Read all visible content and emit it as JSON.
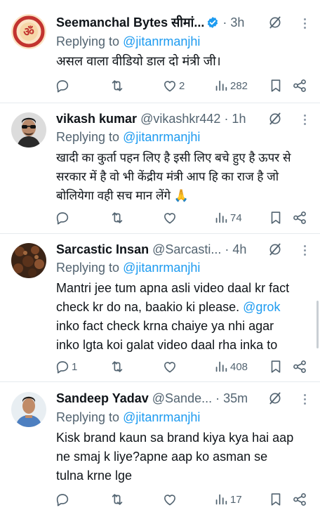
{
  "replies": [
    {
      "name": "Seemanchal Bytes सीमां...",
      "handle": "",
      "time": "· 3h",
      "verified": true,
      "replying_prefix": "Replying to",
      "replying_to": "@jitanrmanjhi",
      "text_lines": [
        "असल वाला वीडियो डाल दो मंत्री जी।"
      ],
      "link": "",
      "counts": {
        "replies": "",
        "reposts": "",
        "likes": "2",
        "views": "282"
      },
      "avatar": "red-ring-logo-with-om-symbol"
    },
    {
      "name": "vikash kumar",
      "handle": "@vikashkr442",
      "time": "· 1h",
      "verified": false,
      "replying_prefix": "Replying to",
      "replying_to": "@jitanrmanjhi",
      "text_lines": [
        "खादी का कुर्ता पहन लिए है इसी लिए बचे हुए है ऊपर से",
        "सरकार में है वो भी केंद्रीय मंत्री आप हि का राज है जो",
        "बोलियेगा वही सच मान लेंगे 🙏"
      ],
      "link": "",
      "counts": {
        "replies": "",
        "reposts": "",
        "likes": "",
        "views": "74"
      },
      "avatar": "man-with-sunglasses"
    },
    {
      "name": "Sarcastic Insan",
      "handle": "@Sarcasti...",
      "time": "· 4h",
      "verified": false,
      "replying_prefix": "Replying to",
      "replying_to": "@jitanrmanjhi",
      "text_lines": [
        "Mantri jee tum apna asli video daal kr fact",
        "check kr do na, baakio ki please. ",
        "inko fact check krna chaiye ya nhi agar",
        "inko lgta koi galat video daal rha inka to"
      ],
      "link": "@grok",
      "counts": {
        "replies": "1",
        "reposts": "",
        "likes": "",
        "views": "408"
      },
      "avatar": "dark-brown-pattern"
    },
    {
      "name": "Sandeep Yadav",
      "handle": "@Sande...",
      "time": "· 35m",
      "verified": false,
      "replying_prefix": "Replying to",
      "replying_to": "@jitanrmanjhi",
      "text_lines": [
        "Kisk brand kaun sa brand kiya kya hai aap",
        "ne smaj k liye?apne aap ko asman se",
        "tulna krne lge"
      ],
      "link": "",
      "counts": {
        "replies": "",
        "reposts": "",
        "likes": "",
        "views": "17"
      },
      "avatar": "man-in-blue-shirt"
    }
  ],
  "colors": {
    "accent": "#1d9bf0",
    "muted": "#536471",
    "text": "#0f1419"
  }
}
